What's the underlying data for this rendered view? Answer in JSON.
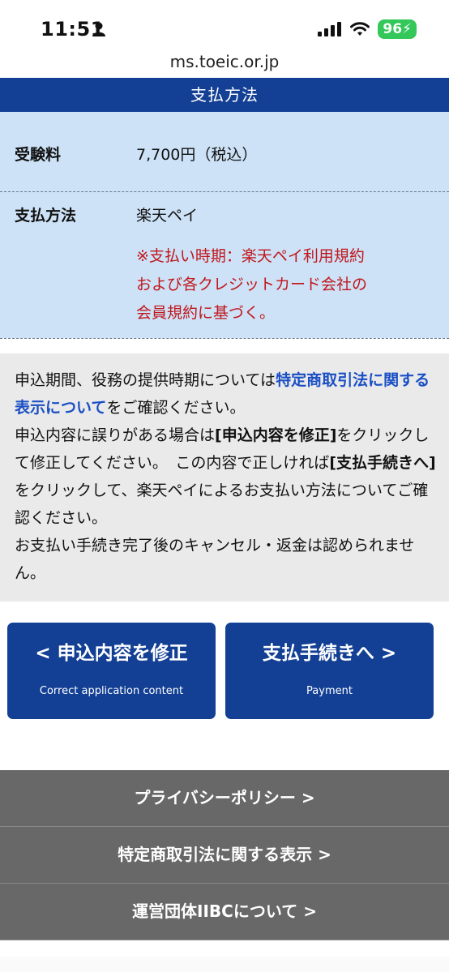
{
  "status_bar": {
    "time": "11:51",
    "battery": "96"
  },
  "browser": {
    "url": "ms.toeic.or.jp"
  },
  "section_title": "支払方法",
  "fee": {
    "label": "受験料",
    "value": "7,700円（税込）"
  },
  "payment": {
    "label": "支払方法",
    "value": "楽天ペイ",
    "note_lines": [
      "※支払い時期：楽天ペイ利用規約",
      "および各クレジットカード会社の",
      "会員規約に基づく。"
    ]
  },
  "description": {
    "p1_before": "申込期間、役務の提供時期については",
    "p1_link": "特定商取引法に関する表示について",
    "p1_after": "をご確認ください。",
    "p2_a": "申込内容に誤りがある場合は",
    "p2_b": "[申込内容を修正]",
    "p2_c": "をクリックして修正してください。　この内容で正しければ",
    "p2_d": "[支払手続きへ]",
    "p2_e": "をクリックして、楽天ペイによるお支払い方法についてご確認ください。",
    "p3": "お支払い手続き完了後のキャンセル・返金は認められません。"
  },
  "buttons": {
    "back_label": "< 申込内容を修正",
    "back_sub": "Correct application content",
    "next_label": "支払手続きへ >",
    "next_sub": "Payment"
  },
  "footer": {
    "links": [
      "プライバシーポリシー >",
      "特定商取引法に関する表示 >",
      "運営団体IIBCについて >"
    ]
  }
}
